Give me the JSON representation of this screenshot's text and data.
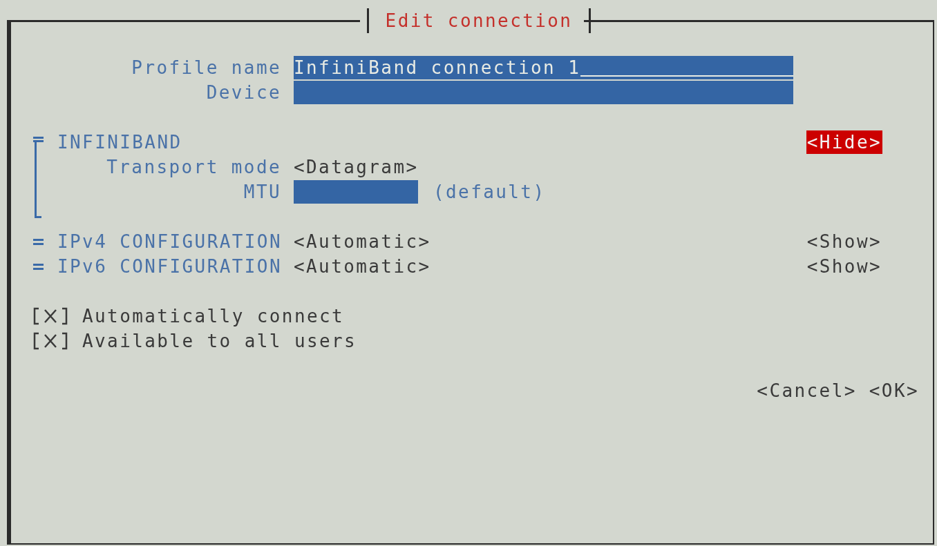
{
  "dialog": {
    "title": "Edit connection"
  },
  "fields": [
    {
      "label": "Profile name",
      "value": "InfiniBand connection 1",
      "focused": true
    },
    {
      "label": "Device",
      "focused": false
    }
  ],
  "sections": [
    {
      "title": "INFINIBAND",
      "expanded": true,
      "toggle": "<Hide>",
      "focused": true,
      "rows": [
        {
          "kind": "dropdown",
          "label": "Transport mode",
          "value": "<Datagram>"
        },
        {
          "kind": "field",
          "label": "MTU",
          "note": "(default)"
        }
      ]
    },
    {
      "title": "IPv4 CONFIGURATION",
      "value": "<Automatic>",
      "expanded": false,
      "toggle": "<Show>",
      "focused": false
    },
    {
      "title": "IPv6 CONFIGURATION",
      "value": "<Automatic>",
      "expanded": false,
      "toggle": "<Show>",
      "focused": false
    }
  ],
  "checkboxes": [
    {
      "label": "Automatically connect",
      "checked": true
    },
    {
      "label": "Available to all users",
      "checked": true
    }
  ],
  "buttons": [
    "<Cancel>",
    "<OK>"
  ]
}
